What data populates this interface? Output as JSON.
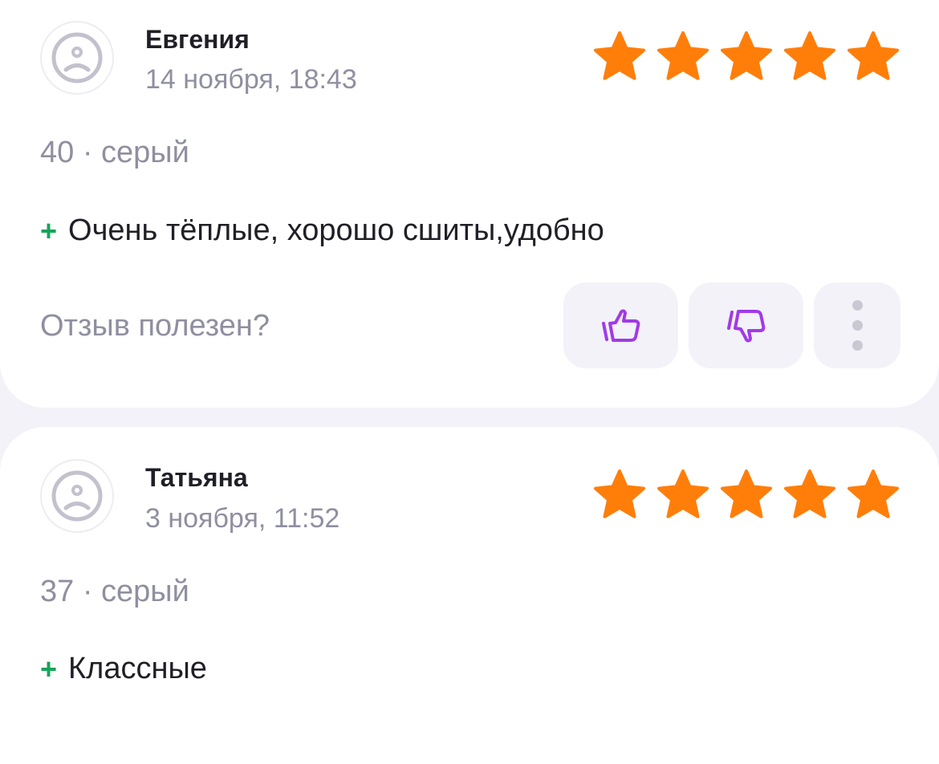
{
  "colors": {
    "star": "#ff7e0a",
    "plus": "#16a35a",
    "vote_icon": "#a23ae6",
    "muted_text": "#8f8fa0",
    "background": "#f3f2f8"
  },
  "reviews": [
    {
      "author": "Евгения",
      "date": "14 ноября, 18:43",
      "rating": 5,
      "size_color": "40 · серый",
      "pros_sign": "+",
      "pros": "Очень тёплые, хорошо сшиты,удобно",
      "helpful_question": "Отзыв полезен?",
      "avatar_icon": "sad-face-icon",
      "like_icon": "thumbs-up-icon",
      "dislike_icon": "thumbs-down-icon",
      "more_icon": "more-vertical-icon"
    },
    {
      "author": "Татьяна",
      "date": "3 ноября, 11:52",
      "rating": 5,
      "size_color": "37 · серый",
      "pros_sign": "+",
      "pros": "Классные",
      "avatar_icon": "sad-face-icon"
    }
  ]
}
